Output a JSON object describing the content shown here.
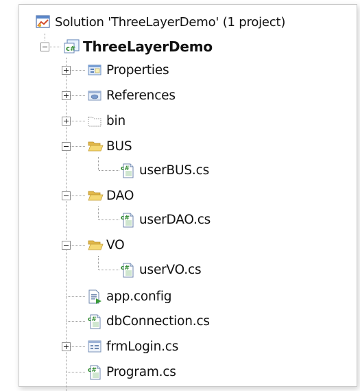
{
  "tree": {
    "solution": {
      "label": "Solution 'ThreeLayerDemo' (1 project)",
      "icon": "solution-icon"
    },
    "project": {
      "label": "ThreeLayerDemo",
      "icon": "csharp-project-icon",
      "expanded": true
    },
    "items": [
      {
        "label": "Properties",
        "icon": "properties-icon",
        "expanded": false
      },
      {
        "label": "References",
        "icon": "references-icon",
        "expanded": false
      },
      {
        "label": "bin",
        "icon": "folder-hidden-icon",
        "expanded": false
      },
      {
        "label": "BUS",
        "icon": "folder-open-icon",
        "expanded": true,
        "children": [
          {
            "label": "userBUS.cs",
            "icon": "csharp-file-icon"
          }
        ]
      },
      {
        "label": "DAO",
        "icon": "folder-open-icon",
        "expanded": true,
        "children": [
          {
            "label": "userDAO.cs",
            "icon": "csharp-file-icon"
          }
        ]
      },
      {
        "label": "VO",
        "icon": "folder-open-icon",
        "expanded": true,
        "children": [
          {
            "label": "userVO.cs",
            "icon": "csharp-file-icon"
          }
        ]
      },
      {
        "label": "app.config",
        "icon": "config-file-icon"
      },
      {
        "label": "dbConnection.cs",
        "icon": "csharp-file-icon"
      },
      {
        "label": "frmLogin.cs",
        "icon": "form-icon",
        "expanded": false
      },
      {
        "label": "Program.cs",
        "icon": "csharp-file-icon"
      }
    ]
  },
  "colors": {
    "folder": "#f3d36b",
    "csharp_green": "#2f8a2f",
    "tree_lines": "#9a9a9a"
  }
}
